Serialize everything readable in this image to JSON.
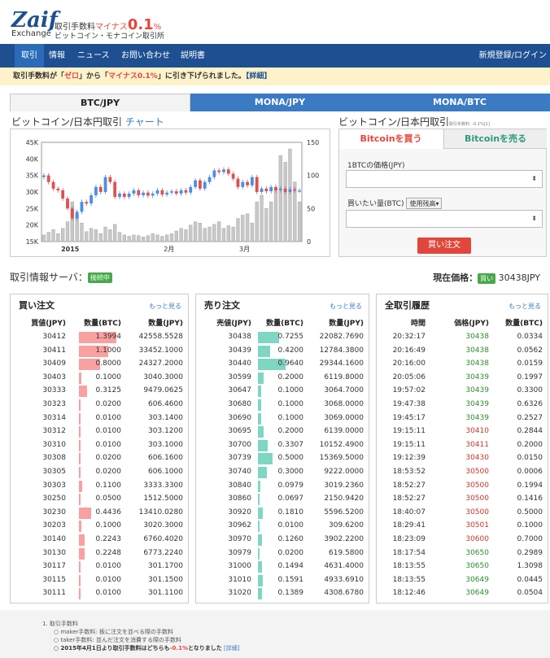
{
  "header": {
    "logo": "Zaif",
    "logo_sub": "Exchange",
    "fee_label": "取引手数料",
    "fee_minus": "マイナス",
    "fee_value": "0.1",
    "fee_pct": "%",
    "site_sub": "ビットコイン・モナコイン取引所"
  },
  "nav": {
    "items": [
      "取引",
      "情報",
      "ニュース",
      "お問い合わせ",
      "説明書"
    ],
    "right": "新規登録/ログイン"
  },
  "notice": {
    "pre": "取引手数料が「",
    "zero": "ゼロ",
    "mid": "」から「",
    "minus": "マイナス0.1%",
    "post": "」に引き下げられました。",
    "link": "【詳細】"
  },
  "tabs": [
    "BTC/JPY",
    "MONA/JPY",
    "MONA/BTC"
  ],
  "chart_section": {
    "title": "ビットコイン/日本円取引",
    "link": "チャート"
  },
  "trade_section": {
    "title": "ビットコイン/日本円取引",
    "fee_note": "取引手数料: -0.1%[1]"
  },
  "trade_form": {
    "buy_tab": "Bitcoinを買う",
    "sell_tab": "Bitcoinを売る",
    "price_label": "1BTCの価格(JPY)",
    "amount_label": "買いたい量(BTC)",
    "balance_select": "使用残高▾",
    "submit": "買い注文",
    "spinner": "⬍"
  },
  "chart_data": {
    "type": "candlestick",
    "left_axis": [
      "45K",
      "40K",
      "35K",
      "30K",
      "25K",
      "20K",
      "15K"
    ],
    "right_axis": [
      "150",
      "100",
      "50",
      "0"
    ],
    "x_labels": [
      "2015",
      "2月",
      "3月"
    ],
    "price_ylim": [
      15000,
      45000
    ],
    "volume_ylim": [
      0,
      150
    ],
    "candles": [
      {
        "o": 34500,
        "c": 35000,
        "v": 10
      },
      {
        "o": 35000,
        "c": 33000,
        "v": 14
      },
      {
        "o": 33000,
        "c": 31000,
        "v": 18
      },
      {
        "o": 31000,
        "c": 30500,
        "v": 12
      },
      {
        "o": 30500,
        "c": 28000,
        "v": 20
      },
      {
        "o": 28000,
        "c": 25000,
        "v": 30
      },
      {
        "o": 25000,
        "c": 22000,
        "v": 60
      },
      {
        "o": 22000,
        "c": 24000,
        "v": 40
      },
      {
        "o": 24000,
        "c": 27000,
        "v": 28
      },
      {
        "o": 27000,
        "c": 26500,
        "v": 15
      },
      {
        "o": 26500,
        "c": 29000,
        "v": 20
      },
      {
        "o": 29000,
        "c": 31500,
        "v": 18
      },
      {
        "o": 31500,
        "c": 30000,
        "v": 12
      },
      {
        "o": 30000,
        "c": 34500,
        "v": 22
      },
      {
        "o": 34500,
        "c": 33000,
        "v": 18
      },
      {
        "o": 33000,
        "c": 28500,
        "v": 26
      },
      {
        "o": 28500,
        "c": 29500,
        "v": 14
      },
      {
        "o": 29500,
        "c": 28500,
        "v": 10
      },
      {
        "o": 28500,
        "c": 29500,
        "v": 8
      },
      {
        "o": 29500,
        "c": 30500,
        "v": 10
      },
      {
        "o": 30500,
        "c": 29000,
        "v": 9
      },
      {
        "o": 29000,
        "c": 29800,
        "v": 7
      },
      {
        "o": 29800,
        "c": 28900,
        "v": 9
      },
      {
        "o": 28900,
        "c": 29500,
        "v": 12
      },
      {
        "o": 29500,
        "c": 30500,
        "v": 10
      },
      {
        "o": 30500,
        "c": 29200,
        "v": 8
      },
      {
        "o": 29200,
        "c": 29800,
        "v": 10
      },
      {
        "o": 29800,
        "c": 30200,
        "v": 12
      },
      {
        "o": 30200,
        "c": 29500,
        "v": 16
      },
      {
        "o": 29500,
        "c": 30500,
        "v": 20
      },
      {
        "o": 30500,
        "c": 29800,
        "v": 18
      },
      {
        "o": 29800,
        "c": 31500,
        "v": 25
      },
      {
        "o": 31500,
        "c": 33500,
        "v": 30
      },
      {
        "o": 33500,
        "c": 31000,
        "v": 28
      },
      {
        "o": 31000,
        "c": 33000,
        "v": 20
      },
      {
        "o": 33000,
        "c": 34500,
        "v": 22
      },
      {
        "o": 34500,
        "c": 36500,
        "v": 26
      },
      {
        "o": 36500,
        "c": 36000,
        "v": 30
      },
      {
        "o": 36000,
        "c": 36800,
        "v": 20
      },
      {
        "o": 36800,
        "c": 35500,
        "v": 24
      },
      {
        "o": 35500,
        "c": 34000,
        "v": 22
      },
      {
        "o": 34000,
        "c": 31500,
        "v": 35
      },
      {
        "o": 31500,
        "c": 33000,
        "v": 40
      },
      {
        "o": 33000,
        "c": 32000,
        "v": 42
      },
      {
        "o": 32000,
        "c": 34500,
        "v": 28
      },
      {
        "o": 34500,
        "c": 30000,
        "v": 60
      },
      {
        "o": 30000,
        "c": 31000,
        "v": 70
      },
      {
        "o": 31000,
        "c": 30200,
        "v": 50
      },
      {
        "o": 30200,
        "c": 31500,
        "v": 60
      },
      {
        "o": 31500,
        "c": 30500,
        "v": 80
      },
      {
        "o": 30500,
        "c": 31000,
        "v": 130
      },
      {
        "o": 31000,
        "c": 30000,
        "v": 120
      },
      {
        "o": 30000,
        "c": 30800,
        "v": 140
      },
      {
        "o": 30800,
        "c": 30400,
        "v": 90
      },
      {
        "o": 30400,
        "c": 30438,
        "v": 60
      }
    ]
  },
  "server": {
    "label": "取引情報サーバ：",
    "status": "接続中"
  },
  "current_price": {
    "label": "現在価格：",
    "badge": "買い",
    "value": "30438JPY"
  },
  "buy_orders": {
    "title": "買い注文",
    "more": "もっと見る",
    "headers": [
      "買値(JPY)",
      "数量(BTC)",
      "数量(JPY)"
    ],
    "rows": [
      {
        "price": "30412",
        "btc": "1.3994",
        "jpy": "42558.5528",
        "amt": 1.3994
      },
      {
        "price": "30411",
        "btc": "1.1000",
        "jpy": "33452.1000",
        "amt": 1.1
      },
      {
        "price": "30409",
        "btc": "0.8000",
        "jpy": "24327.2000",
        "amt": 0.8
      },
      {
        "price": "30403",
        "btc": "0.1000",
        "jpy": "3040.3000",
        "amt": 0.1
      },
      {
        "price": "30333",
        "btc": "0.3125",
        "jpy": "9479.0625",
        "amt": 0.3125
      },
      {
        "price": "30323",
        "btc": "0.0200",
        "jpy": "606.4600",
        "amt": 0.02
      },
      {
        "price": "30314",
        "btc": "0.0100",
        "jpy": "303.1400",
        "amt": 0.01
      },
      {
        "price": "30312",
        "btc": "0.0100",
        "jpy": "303.1200",
        "amt": 0.01
      },
      {
        "price": "30310",
        "btc": "0.0100",
        "jpy": "303.1000",
        "amt": 0.01
      },
      {
        "price": "30308",
        "btc": "0.0200",
        "jpy": "606.1600",
        "amt": 0.02
      },
      {
        "price": "30305",
        "btc": "0.0200",
        "jpy": "606.1000",
        "amt": 0.02
      },
      {
        "price": "30303",
        "btc": "0.1100",
        "jpy": "3333.3300",
        "amt": 0.11
      },
      {
        "price": "30250",
        "btc": "0.0500",
        "jpy": "1512.5000",
        "amt": 0.05
      },
      {
        "price": "30230",
        "btc": "0.4436",
        "jpy": "13410.0280",
        "amt": 0.4436
      },
      {
        "price": "30203",
        "btc": "0.1000",
        "jpy": "3020.3000",
        "amt": 0.1
      },
      {
        "price": "30140",
        "btc": "0.2243",
        "jpy": "6760.4020",
        "amt": 0.2243
      },
      {
        "price": "30130",
        "btc": "0.2248",
        "jpy": "6773.2240",
        "amt": 0.2248
      },
      {
        "price": "30117",
        "btc": "0.0100",
        "jpy": "301.1700",
        "amt": 0.01
      },
      {
        "price": "30115",
        "btc": "0.0100",
        "jpy": "301.1500",
        "amt": 0.01
      },
      {
        "price": "30111",
        "btc": "0.0100",
        "jpy": "301.1100",
        "amt": 0.01
      }
    ]
  },
  "sell_orders": {
    "title": "売り注文",
    "more": "もっと見る",
    "headers": [
      "売値(JPY)",
      "数量(BTC)",
      "数量(JPY)"
    ],
    "rows": [
      {
        "price": "30438",
        "btc": "0.7255",
        "jpy": "22082.7690",
        "amt": 0.7255
      },
      {
        "price": "30439",
        "btc": "0.4200",
        "jpy": "12784.3800",
        "amt": 0.42
      },
      {
        "price": "30440",
        "btc": "0.9640",
        "jpy": "29344.1600",
        "amt": 0.964
      },
      {
        "price": "30599",
        "btc": "0.2000",
        "jpy": "6119.8000",
        "amt": 0.2
      },
      {
        "price": "30647",
        "btc": "0.1000",
        "jpy": "3064.7000",
        "amt": 0.1
      },
      {
        "price": "30680",
        "btc": "0.1000",
        "jpy": "3068.0000",
        "amt": 0.1
      },
      {
        "price": "30690",
        "btc": "0.1000",
        "jpy": "3069.0000",
        "amt": 0.1
      },
      {
        "price": "30695",
        "btc": "0.2000",
        "jpy": "6139.0000",
        "amt": 0.2
      },
      {
        "price": "30700",
        "btc": "0.3307",
        "jpy": "10152.4900",
        "amt": 0.3307
      },
      {
        "price": "30739",
        "btc": "0.5000",
        "jpy": "15369.5000",
        "amt": 0.5
      },
      {
        "price": "30740",
        "btc": "0.3000",
        "jpy": "9222.0000",
        "amt": 0.3
      },
      {
        "price": "30840",
        "btc": "0.0979",
        "jpy": "3019.2360",
        "amt": 0.0979
      },
      {
        "price": "30860",
        "btc": "0.0697",
        "jpy": "2150.9420",
        "amt": 0.0697
      },
      {
        "price": "30920",
        "btc": "0.1810",
        "jpy": "5596.5200",
        "amt": 0.181
      },
      {
        "price": "30962",
        "btc": "0.0100",
        "jpy": "309.6200",
        "amt": 0.01
      },
      {
        "price": "30970",
        "btc": "0.1260",
        "jpy": "3902.2200",
        "amt": 0.126
      },
      {
        "price": "30979",
        "btc": "0.0200",
        "jpy": "619.5800",
        "amt": 0.02
      },
      {
        "price": "31000",
        "btc": "0.1494",
        "jpy": "4631.4000",
        "amt": 0.1494
      },
      {
        "price": "31010",
        "btc": "0.1591",
        "jpy": "4933.6910",
        "amt": 0.1591
      },
      {
        "price": "31020",
        "btc": "0.1389",
        "jpy": "4308.6780",
        "amt": 0.1389
      }
    ]
  },
  "trades": {
    "title": "全取引履歴",
    "more": "もっと見る",
    "headers": [
      "時間",
      "価格(JPY)",
      "数量(BTC)"
    ],
    "rows": [
      {
        "time": "20:32:17",
        "price": "30438",
        "amt": "0.0334",
        "side": "buy"
      },
      {
        "time": "20:16:49",
        "price": "30438",
        "amt": "0.0562",
        "side": "buy"
      },
      {
        "time": "20:16:00",
        "price": "30438",
        "amt": "0.0159",
        "side": "buy"
      },
      {
        "time": "20:05:06",
        "price": "30439",
        "amt": "0.1997",
        "side": "buy"
      },
      {
        "time": "19:57:02",
        "price": "30439",
        "amt": "0.3300",
        "side": "buy"
      },
      {
        "time": "19:47:38",
        "price": "30439",
        "amt": "0.6326",
        "side": "buy"
      },
      {
        "time": "19:45:17",
        "price": "30439",
        "amt": "0.2527",
        "side": "buy"
      },
      {
        "time": "19:15:11",
        "price": "30410",
        "amt": "0.2844",
        "side": "sell"
      },
      {
        "time": "19:15:11",
        "price": "30411",
        "amt": "0.2000",
        "side": "sell"
      },
      {
        "time": "19:12:39",
        "price": "30430",
        "amt": "0.0150",
        "side": "sell"
      },
      {
        "time": "18:53:52",
        "price": "30500",
        "amt": "0.0006",
        "side": "sell"
      },
      {
        "time": "18:52:27",
        "price": "30500",
        "amt": "0.1994",
        "side": "sell"
      },
      {
        "time": "18:52:27",
        "price": "30500",
        "amt": "0.1416",
        "side": "sell"
      },
      {
        "time": "18:40:07",
        "price": "30500",
        "amt": "0.5000",
        "side": "sell"
      },
      {
        "time": "18:29:41",
        "price": "30501",
        "amt": "0.1000",
        "side": "sell"
      },
      {
        "time": "18:23:09",
        "price": "30600",
        "amt": "0.7000",
        "side": "sell"
      },
      {
        "time": "18:17:54",
        "price": "30650",
        "amt": "0.2989",
        "side": "buy"
      },
      {
        "time": "18:13:55",
        "price": "30650",
        "amt": "1.3098",
        "side": "buy"
      },
      {
        "time": "18:13:55",
        "price": "30649",
        "amt": "0.0445",
        "side": "buy"
      },
      {
        "time": "18:12:46",
        "price": "30649",
        "amt": "0.0504",
        "side": "buy"
      }
    ]
  },
  "colors": {
    "buy_bar": "#f9a0a0",
    "sell_bar": "#7fd6c2",
    "buy_price": "#2e8b2e",
    "sell_price": "#c0392b",
    "nav": "#1e4f91",
    "tab": "#3a7bc4",
    "up_candle": "#4a90e2",
    "down_candle": "#e05050",
    "volume": "#c8c8c8"
  },
  "footer": {
    "n1": "1. 取引手数料",
    "l1": "○ maker手数料: 板に注文を並べる際の手数料",
    "l2": "○ taker手数料: 並んだ注文を消費する際の手数料",
    "l3a": "○ 2015年4月1日より取引手数料はどちらも",
    "l3b": "-0.1%",
    "l3c": "となりました",
    "l3d": "[詳細]"
  }
}
